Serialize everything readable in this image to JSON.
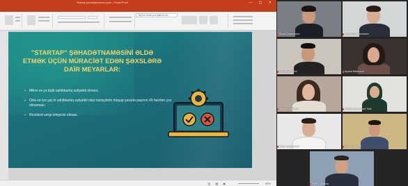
{
  "ppt": {
    "window_title": "Startap şəhadətnaməsi.pptx - PowerPoint",
    "window_controls": "— ▢ ✕",
    "tabs": [
      "File",
      "Home",
      "Insert",
      "Design",
      "Transitions",
      "Animations",
      "Slide Show",
      "Review",
      "View",
      "Help"
    ],
    "active_tab": "Home",
    "tell_me": "Tell me what you want to do",
    "zoom": "95%",
    "status_icons": "▤ ▦ ▣"
  },
  "slide": {
    "title": "\"STARTAP\" ŞƏHADƏTNAMƏSİNİ ƏLDƏ ETMƏK ÜÇÜN MÜRACİƏT EDƏN ŞƏXSLƏRƏ DAİR MEYARLAR:",
    "bullets": [
      "Mikro və ya kiçik sahibkarlıq subyekti olması;",
      "Orta və (və ya) iri sahibkarlıq subyekti olan təsisçilərin hüquqi şəxsdə payının 49 faizdən çox olmaması;",
      "Rezident vergi ödəyicisi olması."
    ],
    "bullet_marker": "➢"
  },
  "participants": [
    {
      "name": "Elmar Suleymanov"
    },
    {
      "name": "Hasan Gulmammadov"
    },
    {
      "name": "Samadzade Ulvi"
    },
    {
      "name": "Aynura Rahimova"
    },
    {
      "name": "Narmin Qasimova"
    },
    {
      "name": "Zahida Mahammad Tahir"
    },
    {
      "name": "Elmar Suleymanov"
    },
    {
      "name": "Jamil Ismayilov"
    },
    {
      "name": "Farid Gurbanov"
    }
  ],
  "colors": {
    "ppt_accent": "#c43e1c",
    "slide_title": "#f2d46b",
    "slide_bg": "#1c6f7b",
    "mute_red": "#e04646"
  }
}
